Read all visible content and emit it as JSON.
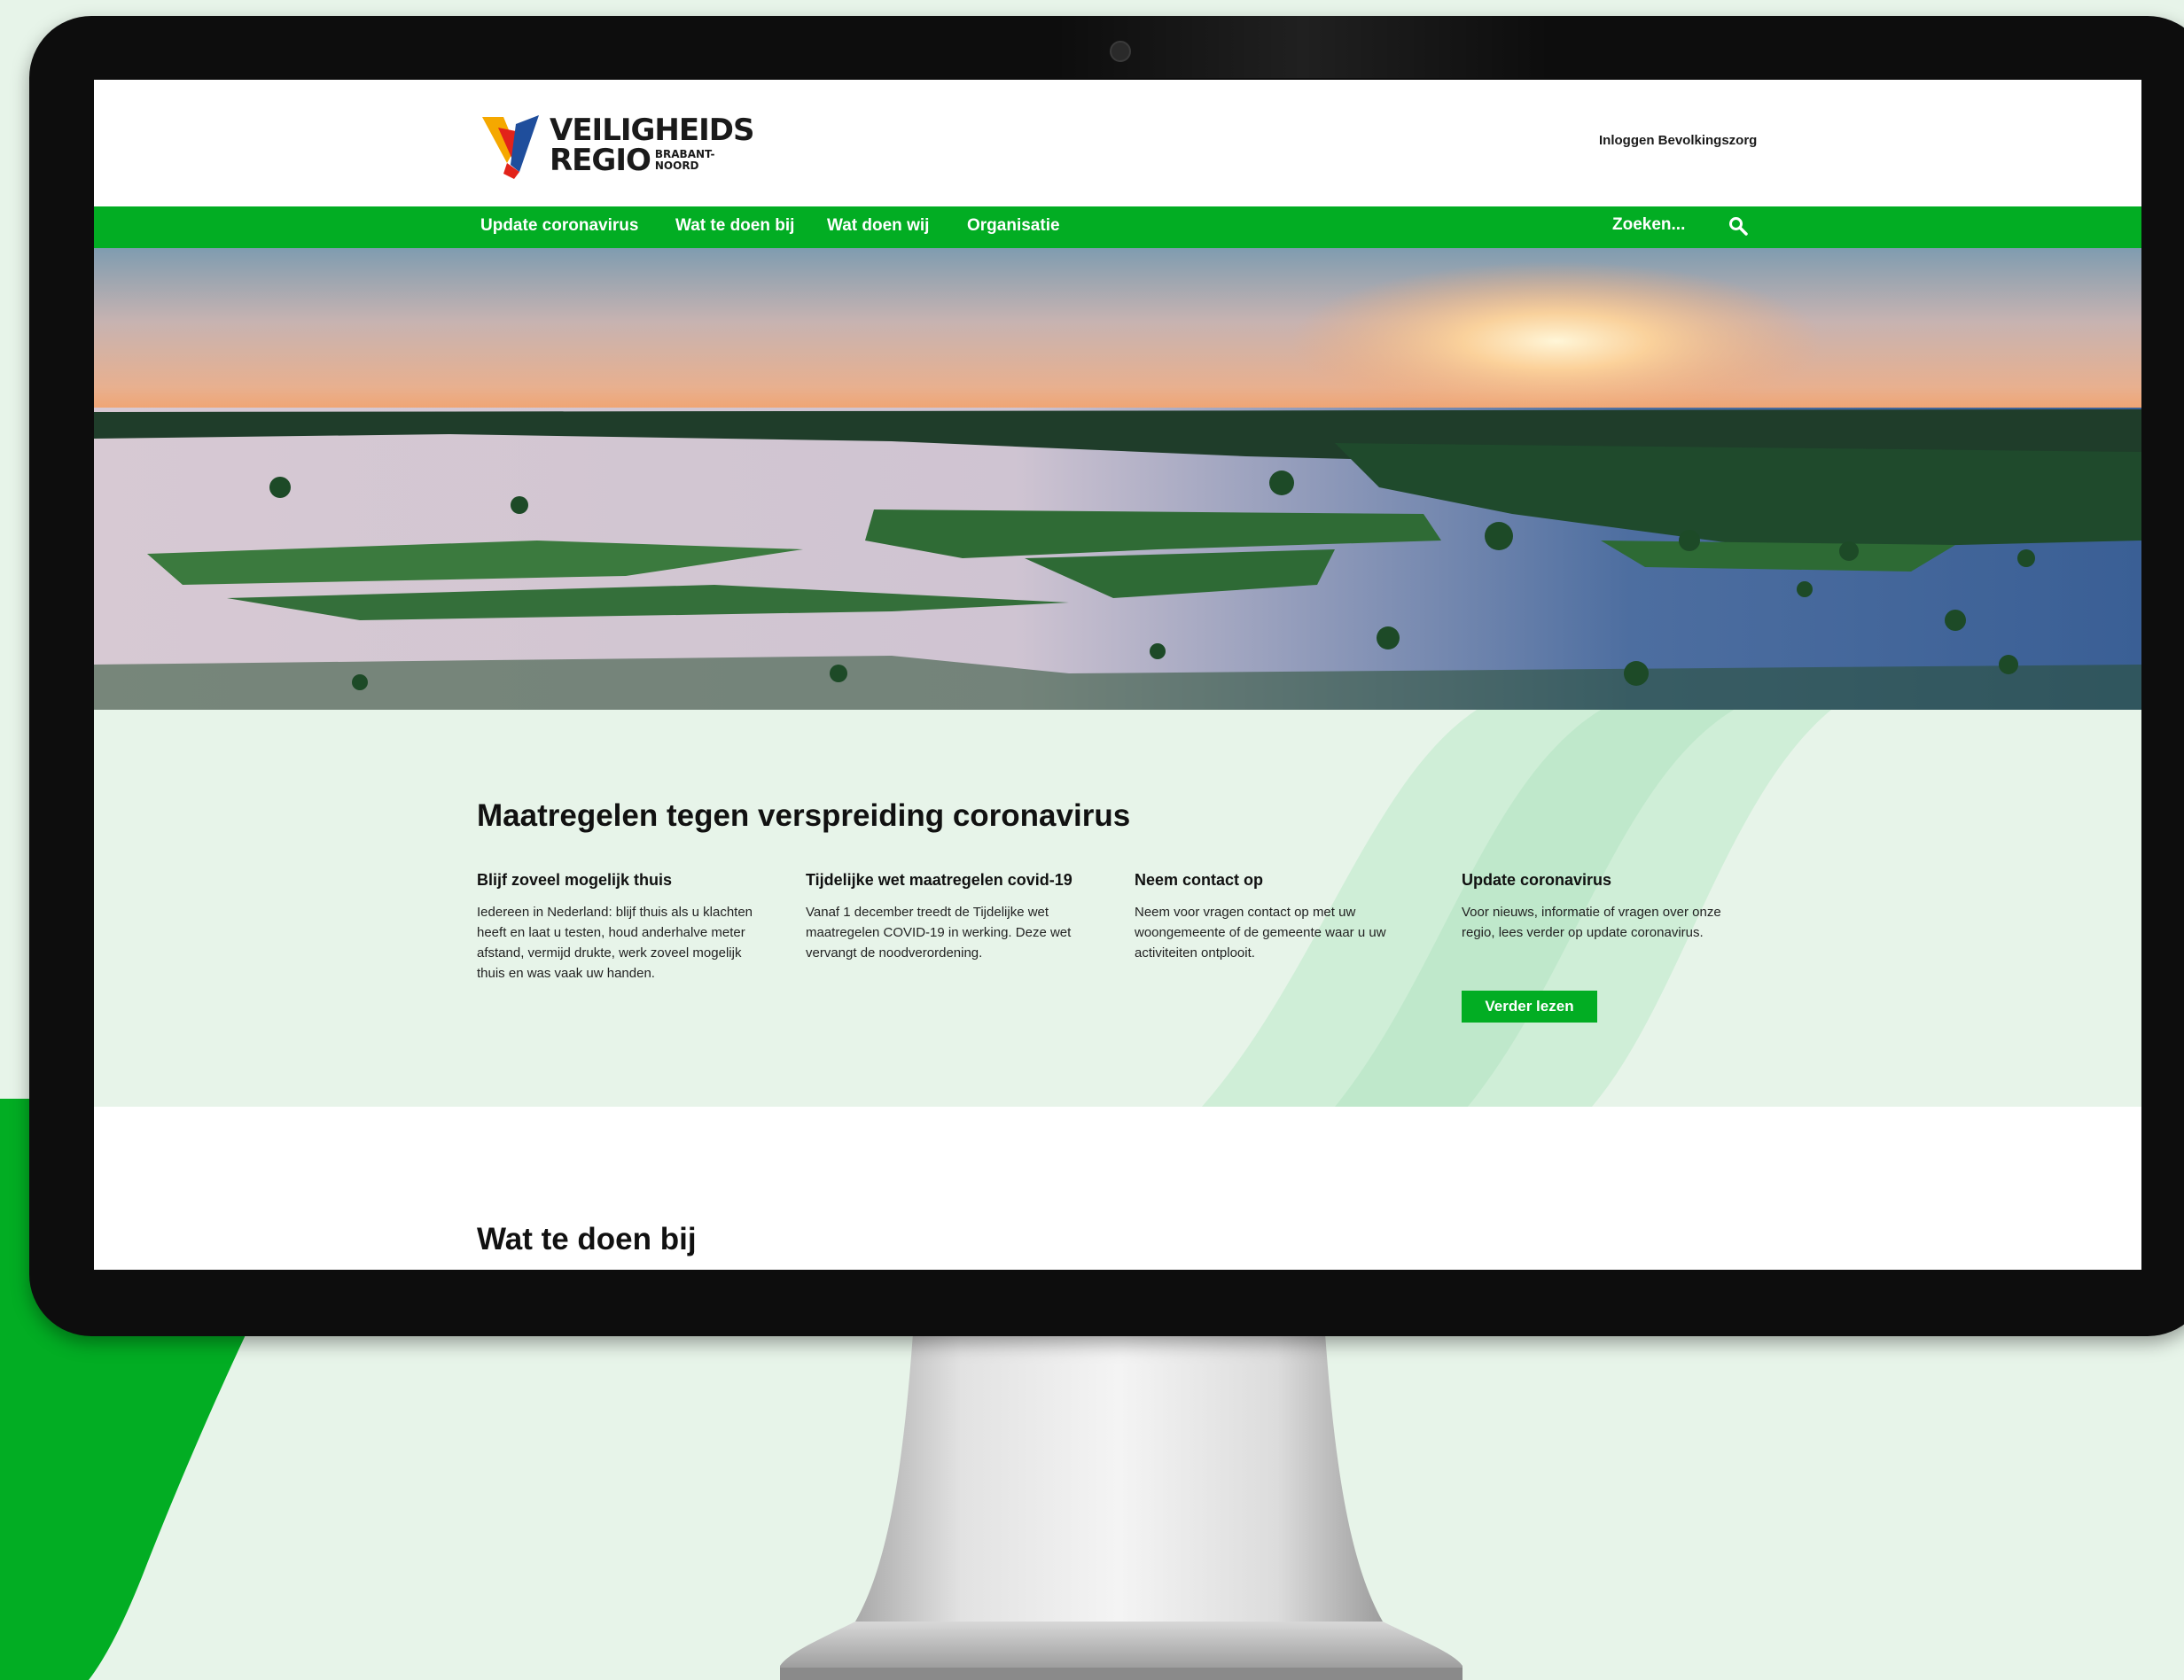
{
  "colors": {
    "brand_green": "#02ad23",
    "light_green_bg": "#e7f4e9",
    "monitor_bezel": "#0d0d0d"
  },
  "logo": {
    "line1": "VEILIGHEIDS",
    "line2": "REGIO",
    "sub1": "BRABANT-",
    "sub2": "NOORD",
    "mark_icon": "veiligheidsregio-logo-icon"
  },
  "header": {
    "login_link": "Inloggen Bevolkingszorg"
  },
  "nav": {
    "items": [
      "Update coronavirus",
      "Wat te doen bij",
      "Wat doen wij",
      "Organisatie"
    ],
    "search_placeholder": "Zoeken...",
    "search_icon": "search-icon"
  },
  "hero": {
    "image": "flooded-landscape-sunset-photo"
  },
  "corona": {
    "title": "Maatregelen tegen verspreiding coronavirus",
    "columns": [
      {
        "heading": "Blijf zoveel mogelijk thuis",
        "text": "Iedereen in Nederland: blijf thuis als u klachten heeft en laat u testen, houd anderhalve meter afstand, vermijd drukte, werk zoveel mogelijk thuis en was vaak uw handen."
      },
      {
        "heading": "Tijdelijke wet maatregelen covid-19",
        "text": "Vanaf 1 december treedt de Tijdelijke wet maatregelen COVID-19 in werking. Deze wet vervangt de noodverordening."
      },
      {
        "heading": "Neem contact op",
        "text": "Neem voor vragen contact op met uw woongemeente of de gemeente waar u uw activiteiten ontplooit."
      },
      {
        "heading": "Update coronavirus",
        "text": "Voor nieuws, informatie of vragen over onze regio, lees verder op update coronavirus."
      }
    ],
    "button_label": "Verder lezen"
  },
  "wat_te_doen": {
    "title": "Wat te doen bij"
  }
}
